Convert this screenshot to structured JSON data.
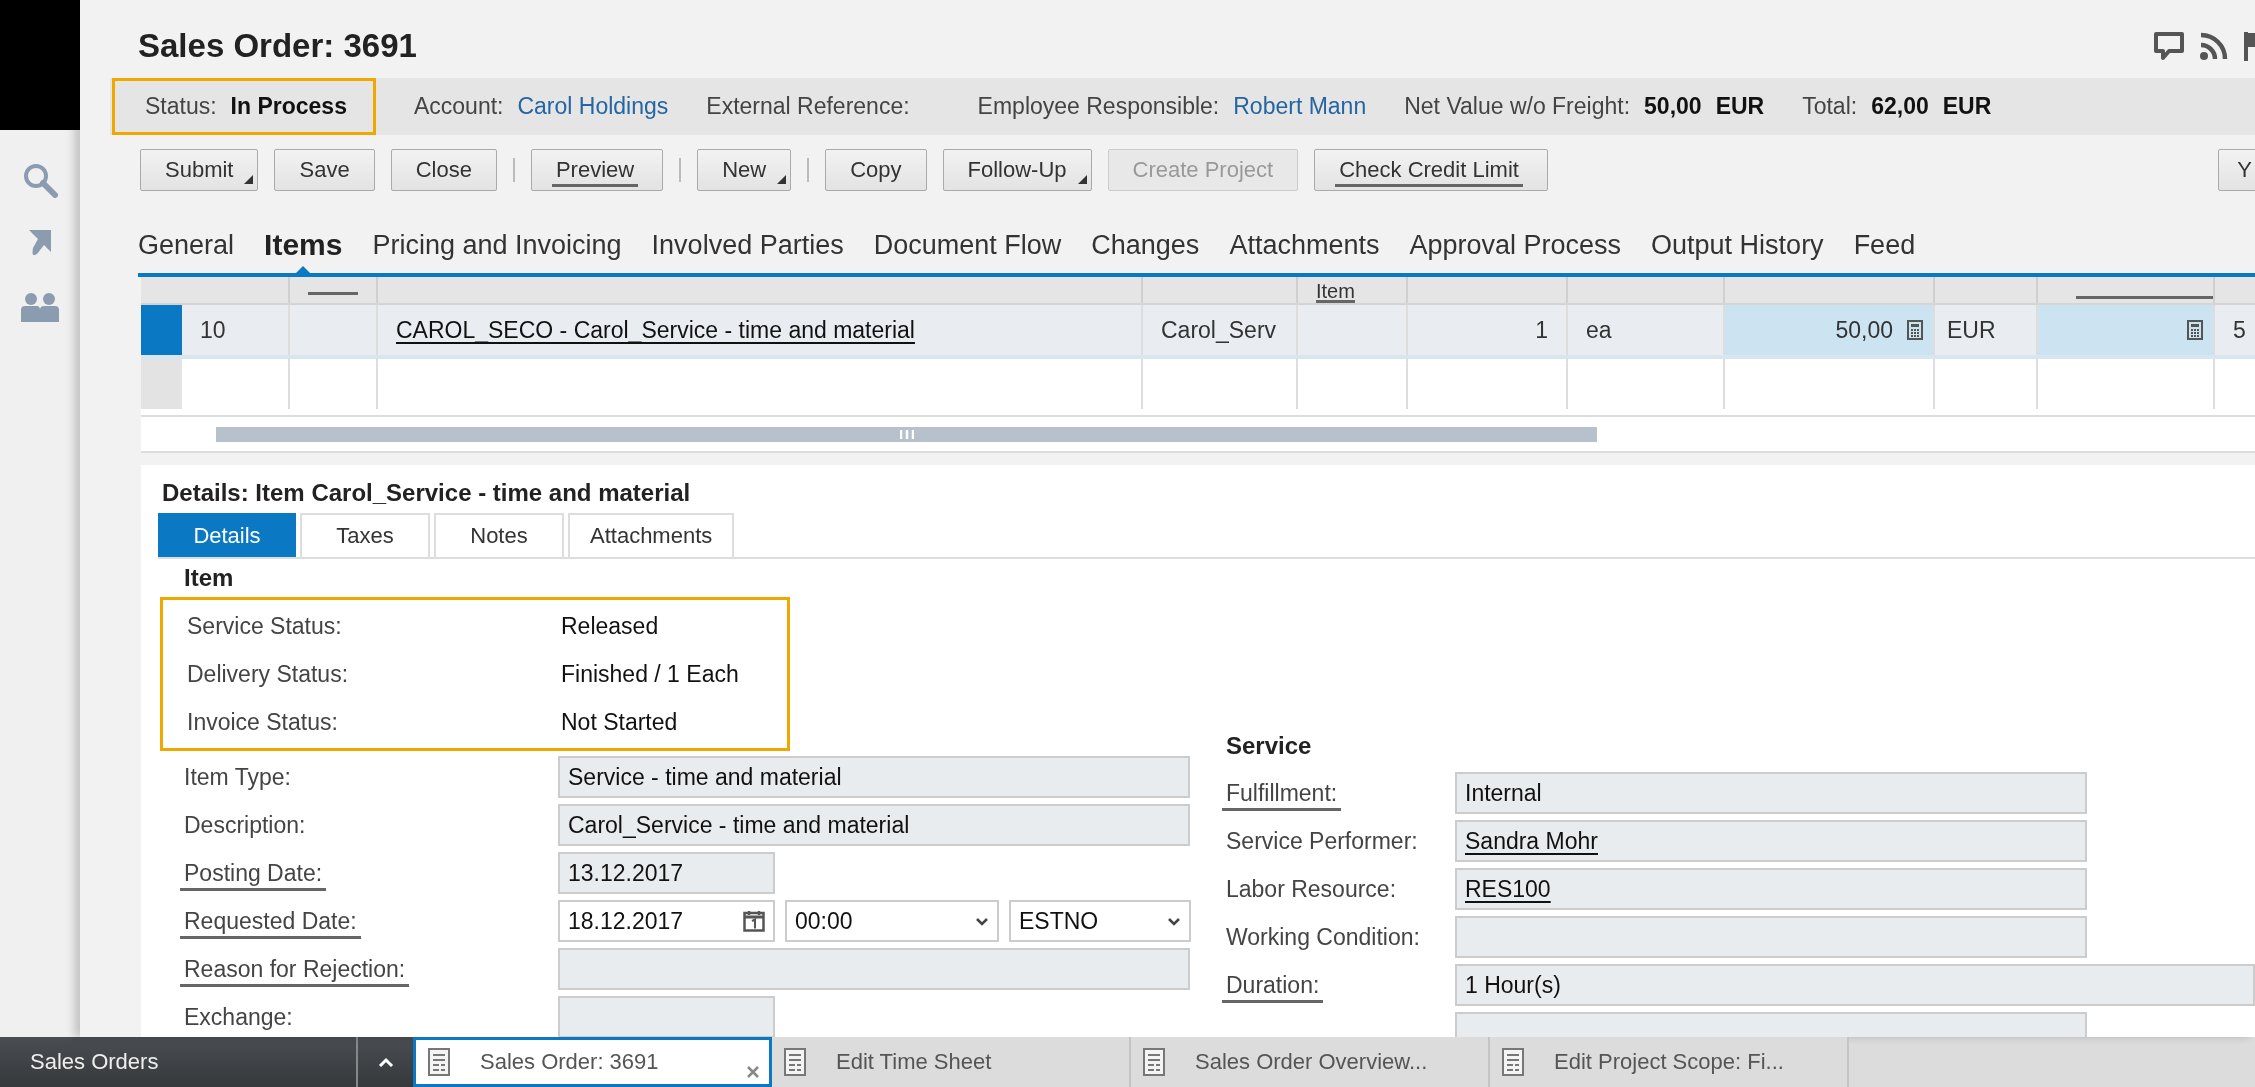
{
  "header": {
    "title": "Sales Order: 3691"
  },
  "info_bar": {
    "status": {
      "label": "Status:",
      "value": "In Process",
      "highlighted": true
    },
    "fields": [
      {
        "label": "Account:",
        "value": "Carol Holdings",
        "kind": "link"
      },
      {
        "label": "External Reference:",
        "kind": "text"
      },
      {
        "label": "Employee Responsible:",
        "value": "Robert Mann",
        "kind": "link"
      },
      {
        "label": "Net Value w/o Freight:",
        "value": "50,00",
        "currency": "EUR",
        "kind": "amount"
      },
      {
        "label": "Total:",
        "value": "62,00",
        "currency": "EUR",
        "kind": "amount"
      }
    ]
  },
  "toolbar": [
    {
      "kind": "button",
      "label": "Submit",
      "menu": true,
      "underlined": false,
      "disabled": false
    },
    {
      "kind": "button",
      "label": "Save",
      "menu": false,
      "underlined": false,
      "disabled": false
    },
    {
      "kind": "button",
      "label": "Close",
      "menu": false,
      "underlined": false,
      "disabled": false
    },
    {
      "kind": "separator"
    },
    {
      "kind": "button",
      "label": "Preview",
      "menu": false,
      "underlined": true,
      "disabled": false
    },
    {
      "kind": "separator"
    },
    {
      "kind": "button",
      "label": "New",
      "menu": true,
      "underlined": false,
      "disabled": false
    },
    {
      "kind": "separator"
    },
    {
      "kind": "button",
      "label": "Copy",
      "menu": false,
      "underlined": false,
      "disabled": false
    },
    {
      "kind": "button",
      "label": "Follow-Up",
      "menu": true,
      "underlined": false,
      "disabled": false
    },
    {
      "kind": "button",
      "label": "Create Project",
      "menu": false,
      "underlined": false,
      "disabled": true
    },
    {
      "kind": "button",
      "label": "Check Credit Limit",
      "menu": false,
      "underlined": true,
      "disabled": false
    },
    {
      "kind": "edge",
      "label": "Y",
      "underlined": false,
      "disabled": false
    }
  ],
  "tabs": [
    {
      "label": "General",
      "selected": false
    },
    {
      "label": "Items",
      "selected": true
    },
    {
      "label": "Pricing and Invoicing",
      "selected": false
    },
    {
      "label": "Involved Parties",
      "selected": false
    },
    {
      "label": "Document Flow",
      "selected": false
    },
    {
      "label": "Changes",
      "selected": false
    },
    {
      "label": "Attachments",
      "selected": false
    },
    {
      "label": "Approval Process",
      "selected": false
    },
    {
      "label": "Output History",
      "selected": false
    },
    {
      "label": "Feed",
      "selected": false
    }
  ],
  "items_table": {
    "column_5_header": "Item",
    "rows": [
      {
        "selected": true,
        "item": "10",
        "description": "CAROL_SECO - Carol_Service - time and material",
        "column_4": "Carol_Serv",
        "quantity": "1",
        "unit": "ea",
        "net_value": "50,00",
        "currency": "EUR",
        "column_11": "5"
      },
      {
        "selected": false
      }
    ]
  },
  "details": {
    "title": "Details: Item Carol_Service - time and material",
    "tabs": [
      {
        "label": "Details",
        "selected": true
      },
      {
        "label": "Taxes",
        "selected": false
      },
      {
        "label": "Notes",
        "selected": false
      },
      {
        "label": "Attachments",
        "selected": false
      }
    ],
    "item": {
      "heading": "Item",
      "status_highlighted": true,
      "status_rows": [
        {
          "label": "Service Status:",
          "value": "Released"
        },
        {
          "label": "Delivery Status:",
          "value": "Finished / 1 Each"
        },
        {
          "label": "Invoice Status:",
          "value": "Not Started"
        }
      ],
      "rows": [
        {
          "label": "Item Type:",
          "underlined": false,
          "kind": "field",
          "value": "Service - time and material"
        },
        {
          "label": "Description:",
          "underlined": false,
          "kind": "field",
          "value": "Carol_Service - time and material"
        },
        {
          "label": "Posting Date:",
          "underlined": true,
          "kind": "short",
          "value": "13.12.2017"
        },
        {
          "label": "Requested Date:",
          "underlined": true,
          "kind": "datetime",
          "date": "18.12.2017",
          "time": "00:00",
          "timezone": "ESTNO"
        },
        {
          "label": "Reason for Rejection:",
          "underlined": true,
          "kind": "field"
        },
        {
          "label": "Exchange:",
          "underlined": false,
          "kind": "short"
        }
      ]
    },
    "service": {
      "heading": "Service",
      "rows": [
        {
          "label": "Fulfillment:",
          "underlined": true,
          "kind": "field",
          "value": "Internal",
          "link": false
        },
        {
          "label": "Service Performer:",
          "underlined": false,
          "kind": "field",
          "value": "Sandra Mohr",
          "link": true
        },
        {
          "label": "Labor Resource:",
          "underlined": false,
          "kind": "field",
          "value": "RES100",
          "link": true
        },
        {
          "label": "Working Condition:",
          "underlined": false,
          "kind": "field"
        },
        {
          "label": "Duration:",
          "underlined": true,
          "kind": "wide",
          "value": "1 Hour(s)",
          "link": false
        },
        {
          "kind": "field"
        }
      ]
    }
  },
  "taskbar": {
    "app": "Sales Orders",
    "tabs": [
      {
        "label": "Sales Order: 3691",
        "selected": true,
        "closable": true
      },
      {
        "label": "Edit Time Sheet",
        "selected": false,
        "closable": false
      },
      {
        "label": "Sales Order Overview...",
        "selected": false,
        "closable": false
      },
      {
        "label": "Edit Project Scope: Fi...",
        "selected": false,
        "closable": false
      }
    ]
  }
}
